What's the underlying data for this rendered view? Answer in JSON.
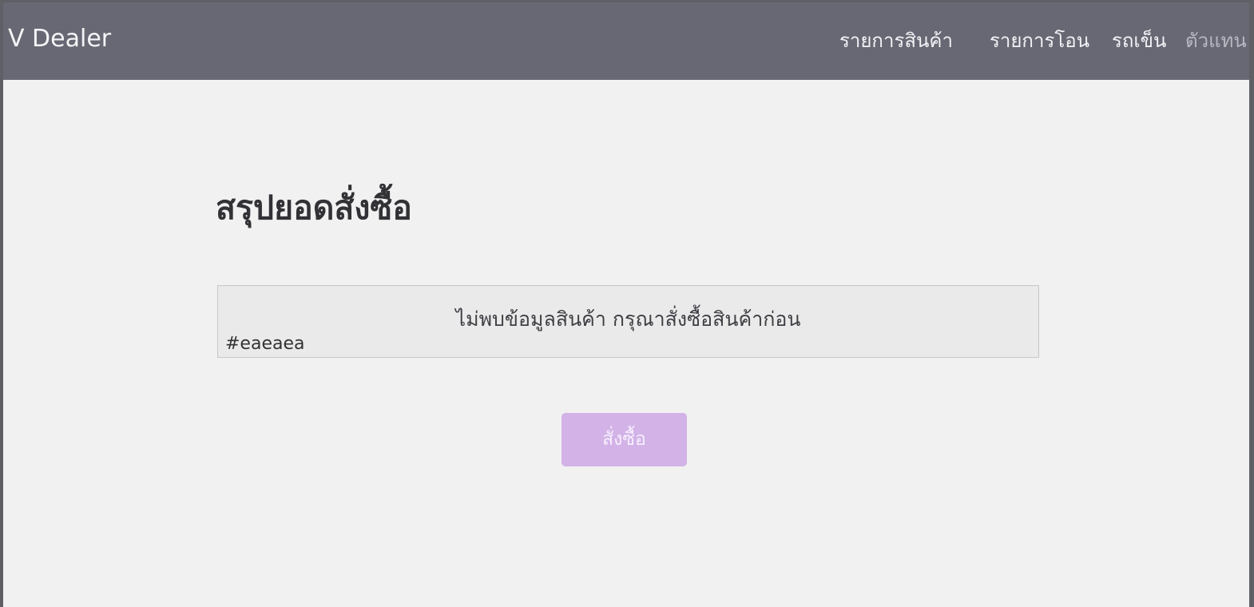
{
  "header": {
    "brand": "V Dealer",
    "nav": {
      "products": "รายการสินค้า",
      "transfers": "รายการโอน",
      "trolley": "รถเข็น",
      "dealer": "ตัวแทน"
    }
  },
  "main": {
    "title": "สรุปยอดสั่งซื้อ",
    "empty_state": {
      "message": "ไม่พบข้อมูลสินค้า กรุณาสั่งซื้อสินค้าก่อน",
      "note": "#eaeaea"
    },
    "order_button": "สั่งซื้อ"
  },
  "colors": {
    "header_background": "#676873",
    "page_background": "#f1f1f1",
    "empty_box_background": "#eaeaea",
    "button_background": "#d2b2e7"
  }
}
